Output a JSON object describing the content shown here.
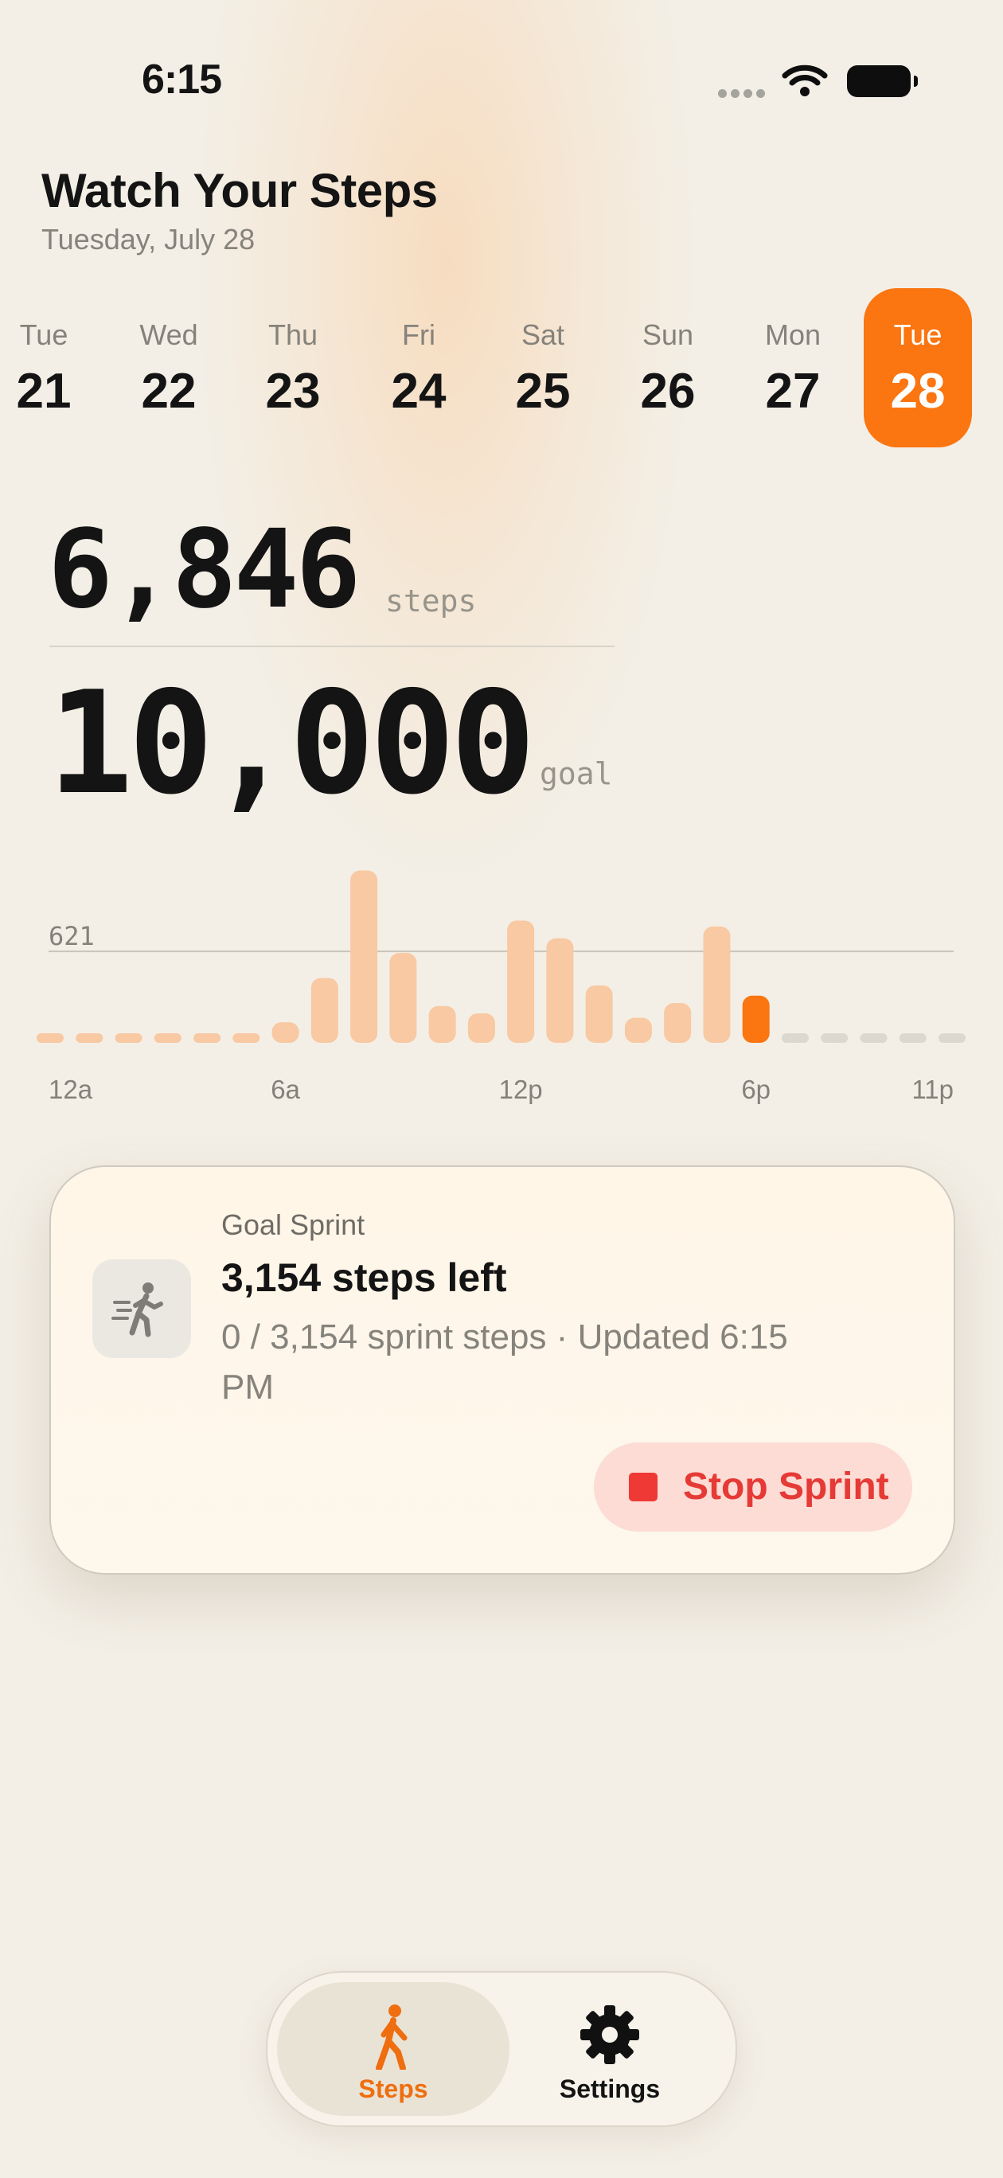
{
  "status_bar": {
    "time": "6:15"
  },
  "header": {
    "title": "Watch Your Steps",
    "date": "Tuesday, July 28"
  },
  "days": [
    {
      "dow": "Tue",
      "num": "21",
      "selected": false
    },
    {
      "dow": "Wed",
      "num": "22",
      "selected": false
    },
    {
      "dow": "Thu",
      "num": "23",
      "selected": false
    },
    {
      "dow": "Fri",
      "num": "24",
      "selected": false
    },
    {
      "dow": "Sat",
      "num": "25",
      "selected": false
    },
    {
      "dow": "Sun",
      "num": "26",
      "selected": false
    },
    {
      "dow": "Mon",
      "num": "27",
      "selected": false
    },
    {
      "dow": "Tue",
      "num": "28",
      "selected": true
    }
  ],
  "summary": {
    "steps": "6,846",
    "steps_unit": "steps",
    "goal": "10,000",
    "goal_unit": "goal"
  },
  "chart_data": {
    "type": "bar",
    "reference_line": {
      "value": 621,
      "label": "621"
    },
    "x_tick_labels": [
      "12a",
      "6a",
      "12p",
      "6p",
      "11p"
    ],
    "hours": [
      0,
      1,
      2,
      3,
      4,
      5,
      6,
      7,
      8,
      9,
      10,
      11,
      12,
      13,
      14,
      15,
      16,
      17,
      18,
      19,
      20,
      21,
      22,
      23
    ],
    "values": [
      0,
      0,
      0,
      0,
      0,
      0,
      140,
      440,
      1170,
      610,
      250,
      200,
      830,
      710,
      390,
      170,
      270,
      790,
      320,
      0,
      0,
      0,
      0,
      0
    ],
    "current_hour": 18,
    "ylim": [
      0,
      1200
    ]
  },
  "sprint_card": {
    "kicker": "Goal Sprint",
    "title": "3,154 steps left",
    "detail": "0 / 3,154 sprint steps · Updated 6:15 PM",
    "button_label": "Stop Sprint",
    "icon": "running-figure-icon"
  },
  "tabbar": {
    "tabs": [
      {
        "label": "Steps",
        "icon": "walking-figure-icon",
        "active": true
      },
      {
        "label": "Settings",
        "icon": "gear-icon",
        "active": false
      }
    ]
  },
  "colors": {
    "accent": "#fb7510",
    "bar_past": "#f8c9a2",
    "bar_current": "#fb7510",
    "bar_future": "#dcd8d0",
    "stop_red": "#e63a36"
  }
}
